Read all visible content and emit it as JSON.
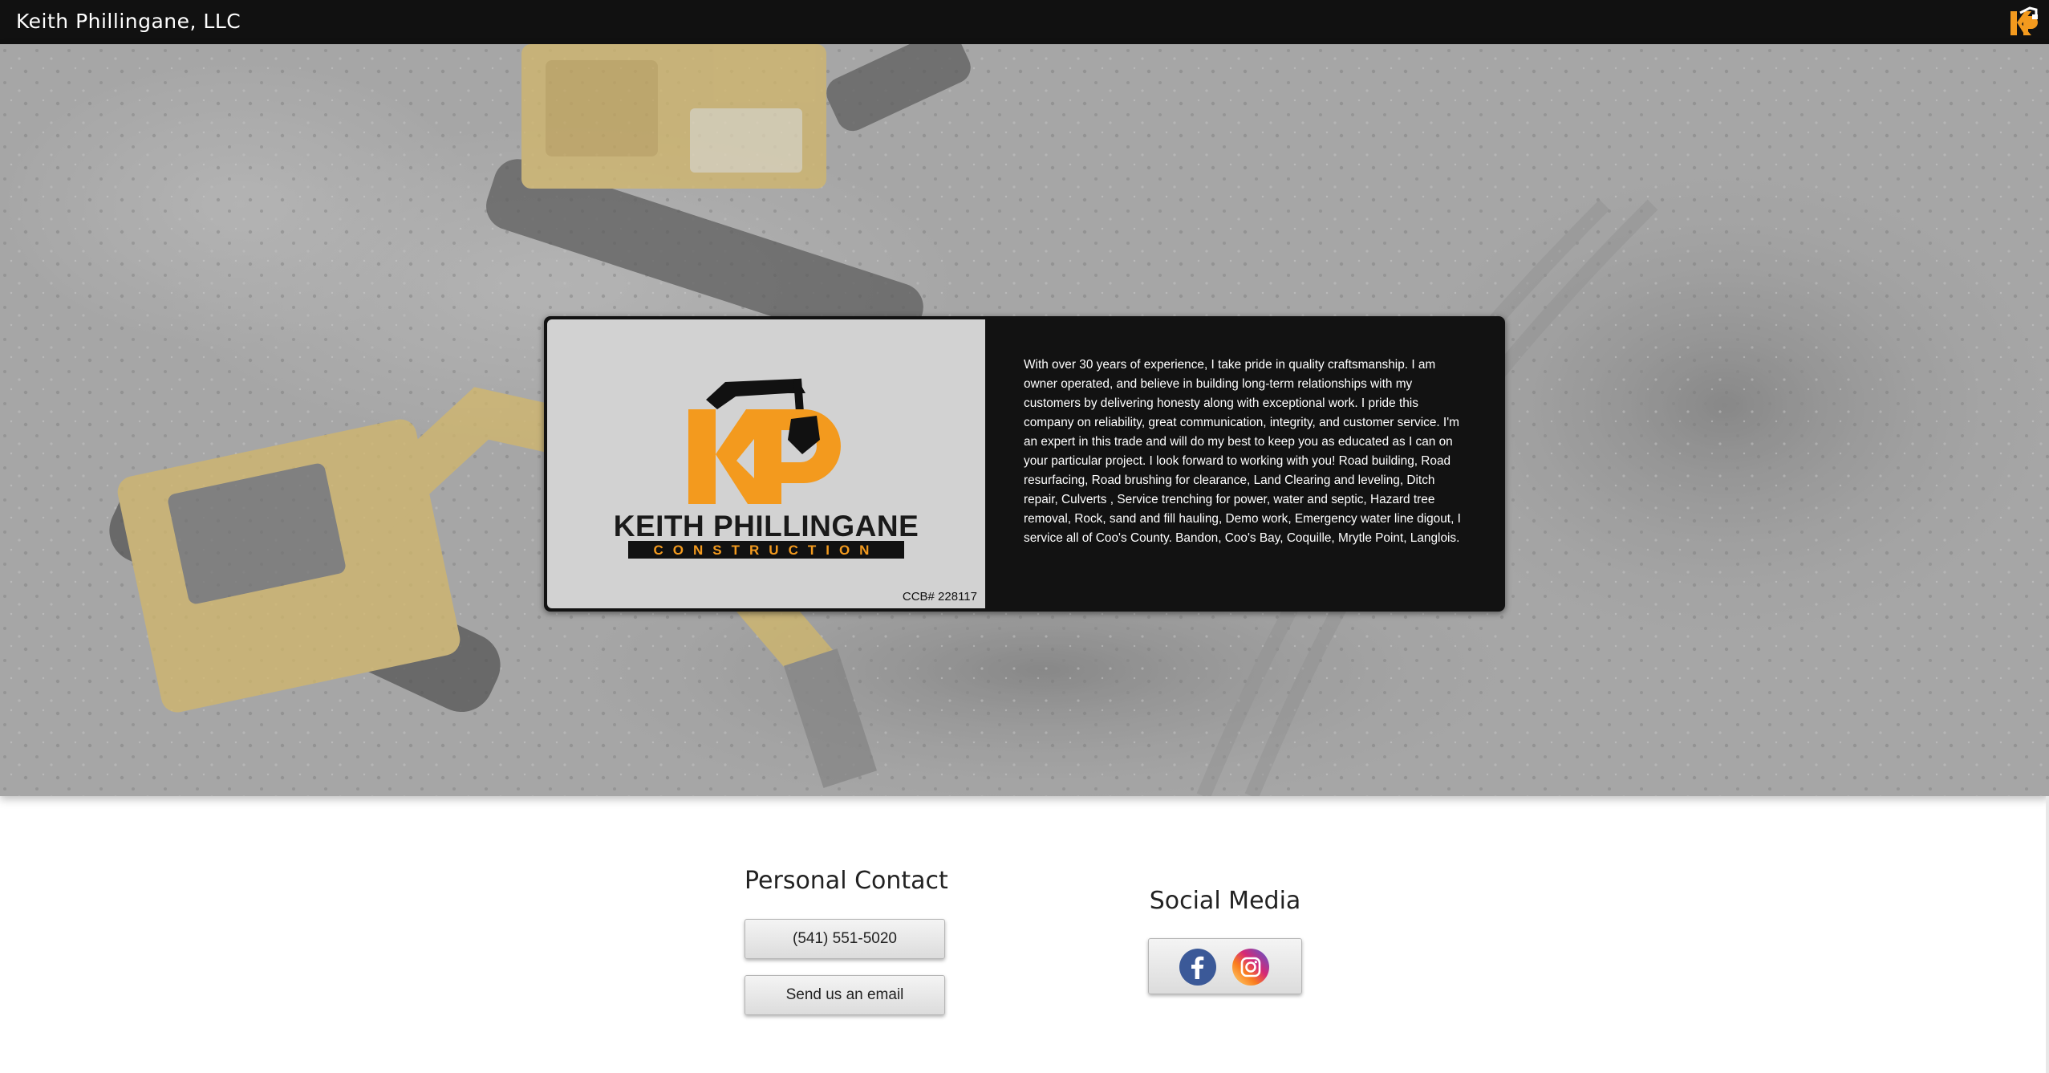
{
  "header": {
    "site_title": "Keith Phillingane, LLC",
    "logo_icon": "kp-logo-icon"
  },
  "hero": {
    "background": "aerial photo of two yellow excavators on a gray dirt construction site",
    "logo": {
      "monogram": "KP",
      "name": "KEITH PHILLINGANE",
      "tagline": "CONSTRUCTION"
    },
    "ccb": "CCB# 228117",
    "about_text": "With over 30 years of experience, I take pride in quality craftsmanship. I am owner operated, and believe in building long-term relationships with my customers by delivering honesty along with exceptional work. I pride this company on reliability, great communication, integrity, and customer service. I'm an expert in this trade and will do my best to keep you as educated as I can on your particular project. I look forward to working with you! Road building, Road resurfacing, Road brushing for clearance, Land Clearing and leveling, Ditch repair, Culverts , Service trenching for power, water and septic, Hazard tree removal, Rock, sand and fill hauling, Demo work, Emergency water line digout, I service all of Coo's County. Bandon, Coo's Bay, Coquille, Mrytle Point, Langlois."
  },
  "contact": {
    "heading": "Personal Contact",
    "phone_label": "(541) 551-5020",
    "email_label": "Send us an email"
  },
  "social": {
    "heading": "Social Media",
    "icons": [
      "facebook-icon",
      "instagram-icon"
    ]
  },
  "colors": {
    "brand_orange": "#f39a1e",
    "topbar": "#111111",
    "card": "#121212",
    "logo_panel": "#d2d2d2"
  }
}
